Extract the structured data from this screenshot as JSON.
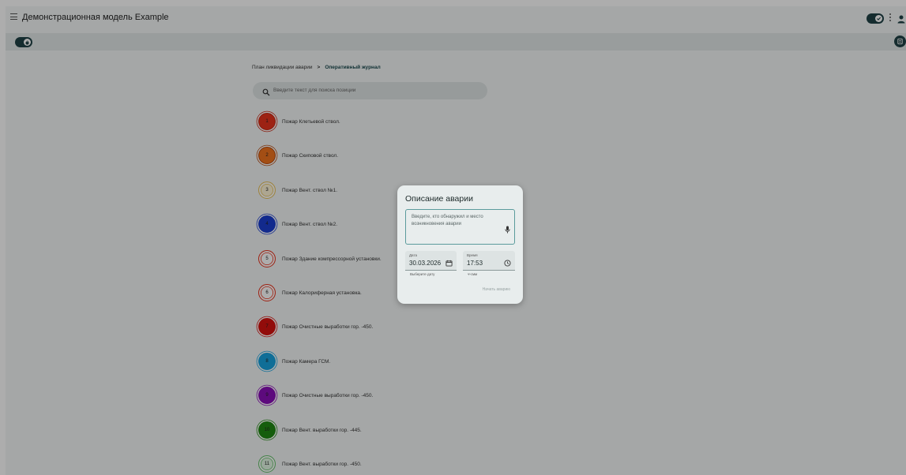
{
  "app": {
    "title": "Демонстрационная модель Example"
  },
  "breadcrumb": {
    "parent": "План ликвидации аварии",
    "separator": ">",
    "current": "Оперативный журнал"
  },
  "search": {
    "placeholder": "Введите текст для поиска позиции"
  },
  "positions": [
    {
      "number": "1",
      "label": "Пожар Клетьевой ствол.",
      "fill": "#e8331d",
      "ring": "#c62a16",
      "style": "filled"
    },
    {
      "number": "2",
      "label": "Пожар Скиповой ствол.",
      "fill": "#f0731e",
      "ring": "#b54a10",
      "style": "filled"
    },
    {
      "number": "3",
      "label": "Пожар Вент. ствол №1.",
      "fill": "#fff5d6",
      "ring": "#e8c25a",
      "style": "outline"
    },
    {
      "number": "4",
      "label": "Пожар Вент. ствол №2.",
      "fill": "#1b3fd0",
      "ring": "#1b3fd0",
      "style": "filled"
    },
    {
      "number": "5",
      "label": "Пожар Здание компрессорной установки.",
      "fill": "#ffffff",
      "ring": "#e8331d",
      "style": "outline"
    },
    {
      "number": "6",
      "label": "Пожар Калориферная установка.",
      "fill": "#ffffff",
      "ring": "#e8331d",
      "style": "outline"
    },
    {
      "number": "7",
      "label": "Пожар Очистные выработки гор. -450.",
      "fill": "#d8130f",
      "ring": "#d8130f",
      "style": "filled"
    },
    {
      "number": "8",
      "label": "Пожар Камера ГСМ.",
      "fill": "#17a3df",
      "ring": "#17a3df",
      "style": "filled"
    },
    {
      "number": "9",
      "label": "Пожар Очистные выработки гор. -450.",
      "fill": "#8a0fb8",
      "ring": "#8a0fb8",
      "style": "filled"
    },
    {
      "number": "10",
      "label": "Пожар Вент. выработки гор. -445.",
      "fill": "#1f8a12",
      "ring": "#1f8a12",
      "style": "filled"
    },
    {
      "number": "11",
      "label": "Пожар Вент. выработки гор. -450.",
      "fill": "#e2f7e3",
      "ring": "#66c26c",
      "style": "outline"
    }
  ],
  "dialog": {
    "title": "Описание аварии",
    "description_placeholder": "Введите, кто обнаружил и место возникновения аварии",
    "date": {
      "label": "Дата",
      "value": "30.03.2026",
      "hint": "Выберите дату"
    },
    "time": {
      "label": "Время",
      "value": "17:53",
      "hint": "чч:мм"
    },
    "start_button": "Начать аварию"
  },
  "colors": {
    "accent": "#1f4246",
    "textarea_border": "#5b9b9c",
    "scrim": "rgba(0,0,0,0.32)"
  }
}
